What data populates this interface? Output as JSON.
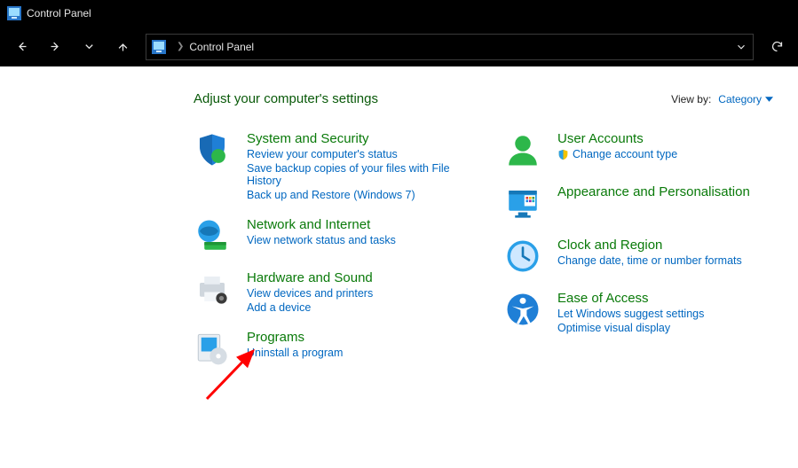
{
  "window": {
    "title": "Control Panel"
  },
  "breadcrumb": {
    "current": "Control Panel"
  },
  "heading": "Adjust your computer's settings",
  "viewby": {
    "label": "View by:",
    "value": "Category"
  },
  "categories": {
    "system_security": {
      "title": "System and Security",
      "links": [
        "Review your computer's status",
        "Save backup copies of your files with File History",
        "Back up and Restore (Windows 7)"
      ]
    },
    "network": {
      "title": "Network and Internet",
      "links": [
        "View network status and tasks"
      ]
    },
    "hardware": {
      "title": "Hardware and Sound",
      "links": [
        "View devices and printers",
        "Add a device"
      ]
    },
    "programs": {
      "title": "Programs",
      "links": [
        "Uninstall a program"
      ]
    },
    "users": {
      "title": "User Accounts",
      "links": [
        "Change account type"
      ],
      "uac": [
        true
      ]
    },
    "appearance": {
      "title": "Appearance and Personalisation",
      "links": []
    },
    "clock": {
      "title": "Clock and Region",
      "links": [
        "Change date, time or number formats"
      ]
    },
    "ease": {
      "title": "Ease of Access",
      "links": [
        "Let Windows suggest settings",
        "Optimise visual display"
      ]
    }
  }
}
